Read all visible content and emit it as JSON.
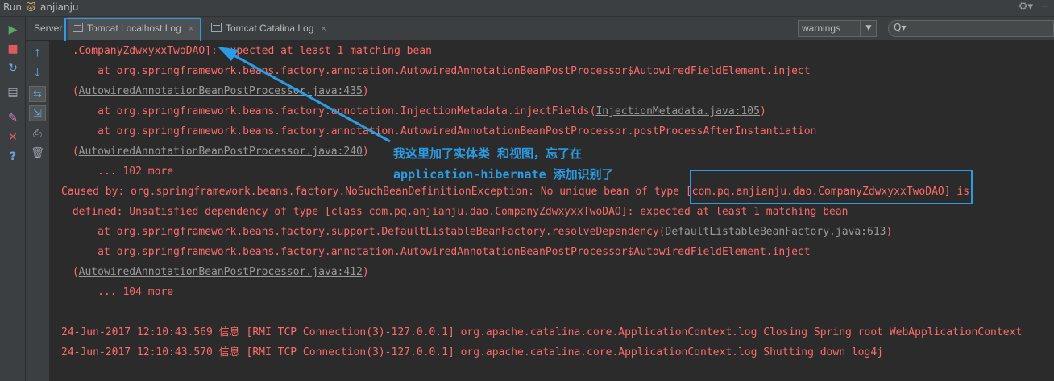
{
  "titlebar": {
    "run_label": "Run",
    "app_name": "anjianju"
  },
  "tabs": {
    "server_label": "Server",
    "localhost_label": "Tomcat Localhost Log",
    "catalina_label": "Tomcat Catalina Log",
    "close_glyph": "×"
  },
  "filter": {
    "selected": "warnings"
  },
  "search": {
    "icon_text": "Q▾"
  },
  "icons": {
    "left_toolbar": [
      "rerun-icon",
      "stop-icon",
      "restart-icon",
      "layout-icon",
      "pin-icon",
      "close-icon",
      "help-icon"
    ],
    "console_toolbar": [
      "scroll-up-icon",
      "scroll-down-icon",
      "soft-wrap-icon",
      "scroll-to-end-icon",
      "print-icon",
      "clear-icon"
    ]
  },
  "colors": {
    "error_text": "#ff6b68",
    "annotation": "#2a9ce5",
    "background": "#2b2b2b"
  },
  "console": {
    "l1": " .CompanyZdwxyxxTwoDAO]: expected at least 1 matching bean",
    "l2a": "     at org.springframework.beans.factory.annotation.AutowiredAnnotationBeanPostProcessor$AutowiredFieldElement.inject",
    "l3a_pre": " (",
    "l3a_link": "AutowiredAnnotationBeanPostProcessor.java:435",
    "l3a_post": ")",
    "l4_pre": "     at org.springframework.beans.factory.annotation.InjectionMetadata.injectFields(",
    "l4_link": "InjectionMetadata.java:105",
    "l4_post": ")",
    "l5": "     at org.springframework.beans.factory.annotation.AutowiredAnnotationBeanPostProcessor.postProcessAfterInstantiation",
    "l6_pre": " (",
    "l6_link": "AutowiredAnnotationBeanPostProcessor.java:240",
    "l6_post": ")",
    "l7": "     ... 102 more",
    "l8": "Caused by: org.springframework.beans.factory.NoSuchBeanDefinitionException: No unique bean of type [com.pq.anjianju.dao.CompanyZdwxyxxTwoDAO] is",
    "l9": " defined: Unsatisfied dependency of type [class com.pq.anjianju.dao.CompanyZdwxyxxTwoDAO]: expected at least 1 matching bean",
    "l10_pre": "     at org.springframework.beans.factory.support.DefaultListableBeanFactory.resolveDependency(",
    "l10_link": "DefaultListableBeanFactory.java:613",
    "l10_post": ")",
    "l11": "     at org.springframework.beans.factory.annotation.AutowiredAnnotationBeanPostProcessor$AutowiredFieldElement.inject",
    "l12_pre": " (",
    "l12_link": "AutowiredAnnotationBeanPostProcessor.java:412",
    "l12_post": ")",
    "l13": "     ... 104 more",
    "l14": "24-Jun-2017 12:10:43.569 信息 [RMI TCP Connection(3)-127.0.0.1] org.apache.catalina.core.ApplicationContext.log Closing Spring root WebApplicationContext",
    "l15": "24-Jun-2017 12:10:43.570 信息 [RMI TCP Connection(3)-127.0.0.1] org.apache.catalina.core.ApplicationContext.log Shutting down log4j"
  },
  "annotation": {
    "line1": "我这里加了实体类 和视图，忘了在",
    "line2": "application-hibernate 添加识别了"
  }
}
